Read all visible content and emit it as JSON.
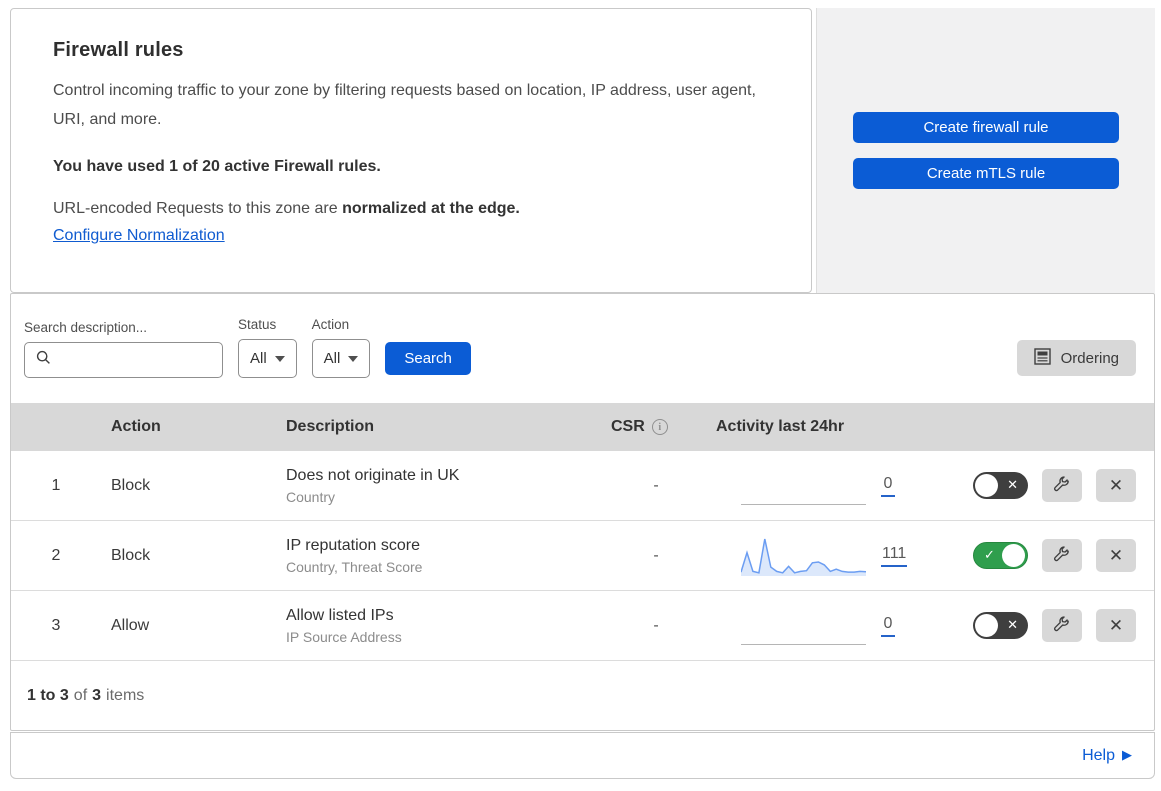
{
  "colors": {
    "accent_blue": "#0b5cd5",
    "link_blue": "#0f5bd0",
    "panel_gray": "#f1f1f2",
    "header_gray": "#d8d8d8",
    "toggle_on_green": "#2f9e4d",
    "toggle_off_dark": "#3f3f3f",
    "sparkline_blue": "#6b9df2"
  },
  "header": {
    "title": "Firewall rules",
    "description": "Control incoming traffic to your zone by filtering requests based on location, IP address, user agent, URI, and more.",
    "usage": "You have used 1 of 20 active Firewall rules.",
    "normalization_prefix": "URL-encoded Requests to this zone are ",
    "normalization_bold": "normalized at the edge.",
    "normalization_link": "Configure Normalization",
    "create_firewall_button": "Create firewall rule",
    "create_mtls_button": "Create mTLS rule"
  },
  "filters": {
    "search_label": "Search description...",
    "status_label": "Status",
    "status_value": "All",
    "action_label": "Action",
    "action_value": "All",
    "search_button": "Search",
    "ordering_button": "Ordering"
  },
  "table": {
    "headers": {
      "action": "Action",
      "description": "Description",
      "csr": "CSR",
      "csr_info": "i",
      "activity": "Activity last 24hr"
    },
    "rows": [
      {
        "num": "1",
        "action": "Block",
        "description": "Does not originate in UK",
        "fields": "Country",
        "csr": "-",
        "activity_count": "0",
        "enabled": false,
        "sparkline": null
      },
      {
        "num": "2",
        "action": "Block",
        "description": "IP reputation score",
        "fields": "Country, Threat Score",
        "csr": "-",
        "activity_count": "111",
        "enabled": true,
        "sparkline": [
          8,
          62,
          10,
          6,
          100,
          22,
          10,
          6,
          24,
          6,
          10,
          12,
          34,
          36,
          28,
          10,
          16,
          10,
          8,
          8,
          10,
          9
        ]
      },
      {
        "num": "3",
        "action": "Allow",
        "description": "Allow listed IPs",
        "fields": "IP Source Address",
        "csr": "-",
        "activity_count": "0",
        "enabled": false,
        "sparkline": null
      }
    ]
  },
  "footer": {
    "range": "1 to 3",
    "of": "of",
    "total": "3",
    "items": "items"
  },
  "help": {
    "label": "Help",
    "arrow": "▶"
  },
  "glyphs": {
    "toggle_on": "✓",
    "toggle_off": "✕",
    "close": "✕"
  }
}
